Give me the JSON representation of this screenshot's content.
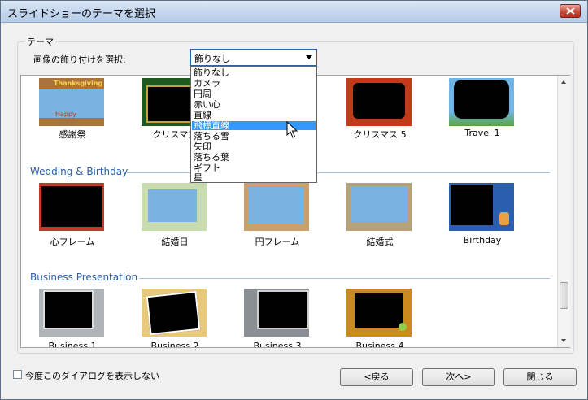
{
  "window": {
    "title": "スライドショーのテーマを選択"
  },
  "group": {
    "legend": "テーマ"
  },
  "select": {
    "label": "画像の飾り付けを選択:",
    "value": "飾りなし"
  },
  "dropdown": {
    "items": [
      "飾りなし",
      "カメラ",
      "円周",
      "赤い心",
      "直線",
      "飛標直線",
      "落ちる雪",
      "矢印",
      "落ちる葉",
      "ギフト",
      "星"
    ],
    "selected_index": 5
  },
  "sections": [
    {
      "name": "",
      "items": [
        "感謝祭",
        "クリスマス",
        "",
        "クリスマス 5",
        "Travel 1"
      ]
    },
    {
      "name": "Wedding & Birthday",
      "items": [
        "心フレーム",
        "結婚日",
        "円フレーム",
        "結婚式",
        "Birthday"
      ]
    },
    {
      "name": "Business Presentation",
      "items": [
        "Business 1",
        "Business 2",
        "Business 3",
        "Business 4"
      ]
    }
  ],
  "thumb_text": {
    "thanksgiving_top": "Thanksgiving",
    "thanksgiving_bottom": "Happy"
  },
  "footer": {
    "checkbox_label": "今度このダイアログを表示しない",
    "back": "<戻る",
    "next": "次へ>",
    "close": "閉じる"
  }
}
